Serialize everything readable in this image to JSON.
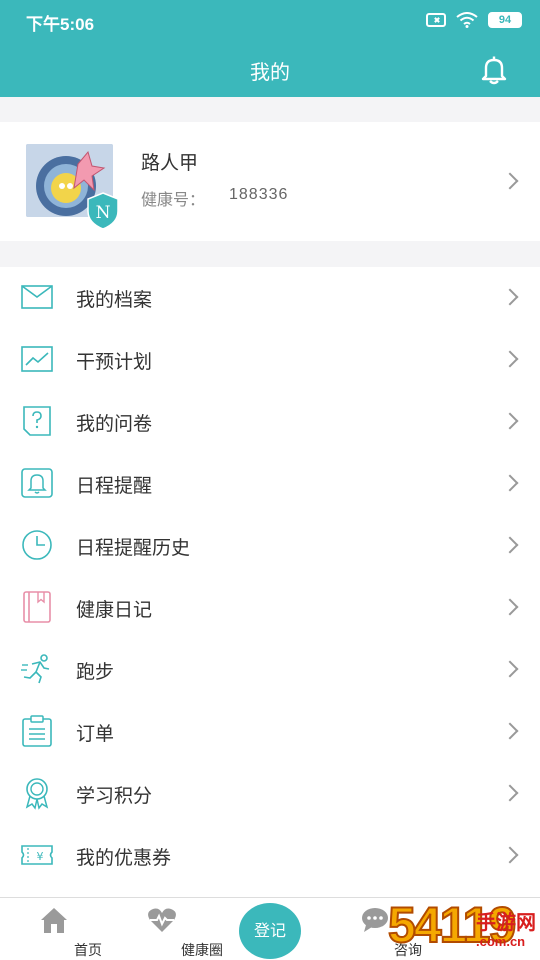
{
  "status_bar": {
    "time": "下午5:06",
    "battery": "94"
  },
  "header": {
    "title": "我的"
  },
  "profile": {
    "name": "路人甲",
    "health_label": "健康号：",
    "health_id": "188336",
    "badge_letter": "N"
  },
  "menu": [
    {
      "label": "我的档案",
      "icon": "envelope-icon",
      "color": "#3bb8bb"
    },
    {
      "label": "干预计划",
      "icon": "trend-chart-icon",
      "color": "#3bb8bb"
    },
    {
      "label": "我的问卷",
      "icon": "question-icon",
      "color": "#3bb8bb"
    },
    {
      "label": "日程提醒",
      "icon": "bell-icon",
      "color": "#3bb8bb"
    },
    {
      "label": "日程提醒历史",
      "icon": "clock-icon",
      "color": "#3bb8bb"
    },
    {
      "label": "健康日记",
      "icon": "diary-icon",
      "color": "#e88fa8"
    },
    {
      "label": "跑步",
      "icon": "runner-icon",
      "color": "#3bb8bb"
    },
    {
      "label": "订单",
      "icon": "order-icon",
      "color": "#3bb8bb"
    },
    {
      "label": "学习积分",
      "icon": "award-icon",
      "color": "#3bb8bb"
    },
    {
      "label": "我的优惠券",
      "icon": "coupon-icon",
      "color": "#3bb8bb"
    }
  ],
  "tabbar": {
    "home": "首页",
    "health_circle": "健康圈",
    "register": "登记",
    "consult": "咨询"
  },
  "watermark": {
    "digits": "54119",
    "cn": "手游网",
    "domain": ".com.cn"
  },
  "colors": {
    "primary": "#3bb8bb",
    "background": "#f4f4f6"
  }
}
